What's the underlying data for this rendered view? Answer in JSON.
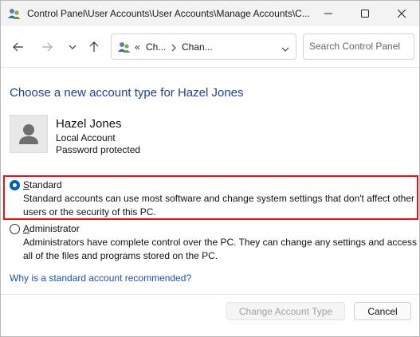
{
  "window": {
    "title": "Control Panel\\User Accounts\\User Accounts\\Manage Accounts\\C..."
  },
  "nav": {
    "breadcrumb": [
      "Ch...",
      "Chan..."
    ],
    "breadcrumb_prefix": "«",
    "search_placeholder": "Search Control Panel"
  },
  "page": {
    "heading": "Choose a new account type for Hazel Jones"
  },
  "user": {
    "name": "Hazel Jones",
    "account_kind": "Local Account",
    "password_status": "Password protected"
  },
  "options": [
    {
      "accesskey": "S",
      "label_rest": "tandard",
      "selected": true,
      "description": "Standard accounts can use most software and change system settings that don't affect other users or the security of this PC."
    },
    {
      "accesskey": "A",
      "label_rest": "dministrator",
      "selected": false,
      "description": "Administrators have complete control over the PC. They can change any settings and access all of the files and programs stored on the PC."
    }
  ],
  "help_link": "Why is a standard account recommended?",
  "buttons": {
    "change_label": "Change Account Type",
    "cancel_label": "Cancel"
  },
  "colors": {
    "heading": "#1e3f8a",
    "link": "#1a52a8",
    "highlight_border": "#e0151c",
    "radio_selected": "#005fb8"
  },
  "icons": {
    "title": "user-accounts-icon",
    "address": "user-accounts-icon",
    "avatar": "user-avatar-icon"
  }
}
